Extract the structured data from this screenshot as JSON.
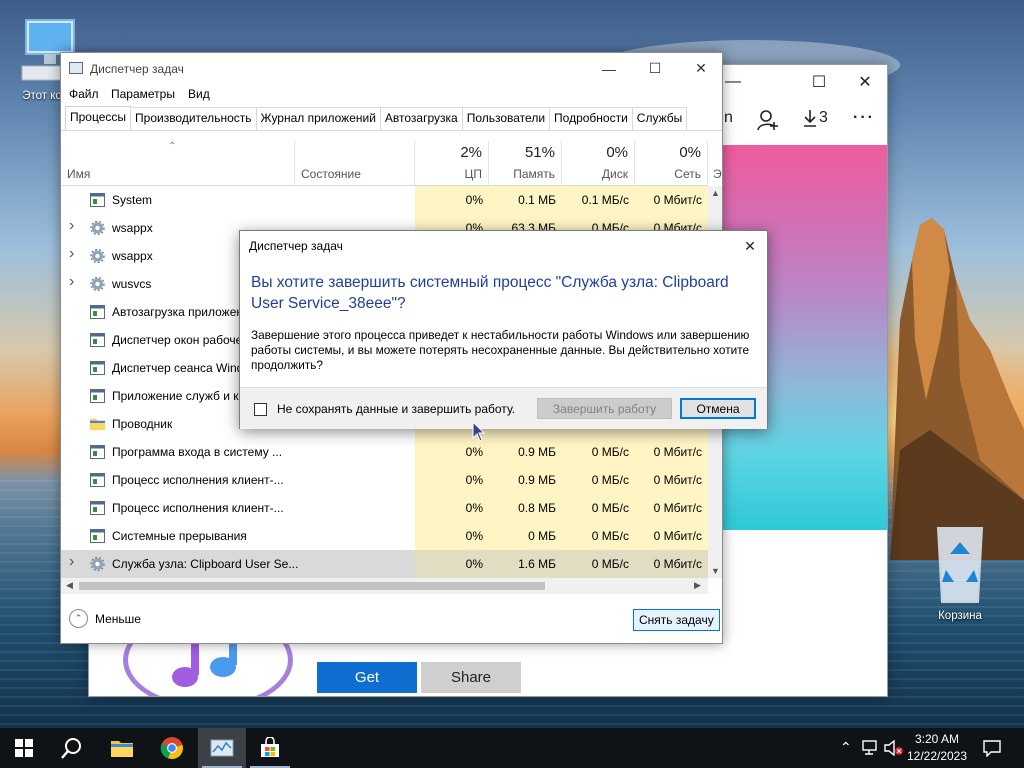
{
  "desktop": {
    "icons": [
      {
        "label": "Этот ком",
        "icon": "this-pc-icon"
      },
      {
        "label": "Корзина",
        "icon": "recycle-bin-icon"
      }
    ]
  },
  "store_window": {
    "toolbar": {
      "download_count": "3",
      "signin_letter": "n"
    },
    "get_label": "Get",
    "share_label": "Share",
    "accent": "#0f6fd0"
  },
  "task_manager": {
    "title": "Диспетчер задач",
    "menu": [
      "Файл",
      "Параметры",
      "Вид"
    ],
    "tabs": [
      "Процессы",
      "Производительность",
      "Журнал приложений",
      "Автозагрузка",
      "Пользователи",
      "Подробности",
      "Службы"
    ],
    "active_tab": "Процессы",
    "columns": {
      "name": "Имя",
      "status": "Состояние",
      "cpu": {
        "percent": "2%",
        "label": "ЦП"
      },
      "memory": {
        "percent": "51%",
        "label": "Память"
      },
      "disk": {
        "percent": "0%",
        "label": "Диск"
      },
      "network": {
        "percent": "0%",
        "label": "Сеть"
      },
      "next_col_initial": "Э"
    },
    "rows": [
      {
        "name": "System",
        "icon": "window-icon",
        "expand": false,
        "cpu": "0%",
        "mem": "0.1 МБ",
        "disk": "0.1 МБ/с",
        "net": "0 Мбит/с"
      },
      {
        "name": "wsappx",
        "icon": "gear-icon",
        "expand": true,
        "cpu": "0%",
        "mem": "63.3 МБ",
        "disk": "0 МБ/с",
        "net": "0 Мбит/с"
      },
      {
        "name": "wsappx",
        "icon": "gear-icon",
        "expand": true,
        "cpu": "",
        "mem": "",
        "disk": "",
        "net": ""
      },
      {
        "name": "wusvcs",
        "icon": "gear-icon",
        "expand": true,
        "cpu": "",
        "mem": "",
        "disk": "",
        "net": ""
      },
      {
        "name": "Автозагрузка приложен",
        "icon": "window-icon",
        "expand": false,
        "cpu": "",
        "mem": "",
        "disk": "",
        "net": ""
      },
      {
        "name": "Диспетчер окон рабоче",
        "icon": "window-icon",
        "expand": false,
        "cpu": "",
        "mem": "",
        "disk": "",
        "net": ""
      },
      {
        "name": "Диспетчер сеанса  Wind",
        "icon": "window-icon",
        "expand": false,
        "cpu": "",
        "mem": "",
        "disk": "",
        "net": ""
      },
      {
        "name": "Приложение служб и ко",
        "icon": "window-icon",
        "expand": false,
        "cpu": "",
        "mem": "",
        "disk": "",
        "net": ""
      },
      {
        "name": "Проводник",
        "icon": "folder-icon",
        "expand": false,
        "cpu": "",
        "mem": "",
        "disk": "",
        "net": ""
      },
      {
        "name": "Программа входа в систему ...",
        "icon": "window-icon",
        "expand": false,
        "cpu": "0%",
        "mem": "0.9 МБ",
        "disk": "0 МБ/с",
        "net": "0 Мбит/с"
      },
      {
        "name": "Процесс исполнения клиент-...",
        "icon": "window-icon",
        "expand": false,
        "cpu": "0%",
        "mem": "0.9 МБ",
        "disk": "0 МБ/с",
        "net": "0 Мбит/с"
      },
      {
        "name": "Процесс исполнения клиент-...",
        "icon": "window-icon",
        "expand": false,
        "cpu": "0%",
        "mem": "0.8 МБ",
        "disk": "0 МБ/с",
        "net": "0 Мбит/с"
      },
      {
        "name": "Системные прерывания",
        "icon": "window-icon",
        "expand": false,
        "cpu": "0%",
        "mem": "0 МБ",
        "disk": "0 МБ/с",
        "net": "0 Мбит/с"
      },
      {
        "name": "Служба узла: Clipboard User Se...",
        "icon": "gear-icon",
        "expand": true,
        "selected": true,
        "cpu": "0%",
        "mem": "1.6 МБ",
        "disk": "0 МБ/с",
        "net": "0 Мбит/с"
      }
    ],
    "fewer_label": "Меньше",
    "end_task_label": "Снять задачу"
  },
  "dialog": {
    "title": "Диспетчер задач",
    "heading": "Вы хотите завершить системный процесс \"Служба узла: Clipboard User Service_38eee\"?",
    "body": "Завершение этого процесса приведет к нестабильности работы Windows или завершению работы системы, и вы можете потерять несохраненные данные. Вы действительно хотите продолжить?",
    "checkbox_label": "Не сохранять данные и завершить работу.",
    "checkbox_checked": false,
    "end_button": "Завершить работу",
    "cancel_button": "Отмена",
    "heading_color": "#1f3f99"
  },
  "taskbar": {
    "items": [
      "start-icon",
      "search-icon",
      "file-explorer-icon",
      "chrome-icon",
      "task-manager-icon",
      "store-icon"
    ],
    "clock_time": "3:20 AM",
    "clock_date": "12/22/2023",
    "tray": [
      "chevron-up-icon",
      "network-icon",
      "volume-muted-icon",
      "notification-icon"
    ]
  }
}
